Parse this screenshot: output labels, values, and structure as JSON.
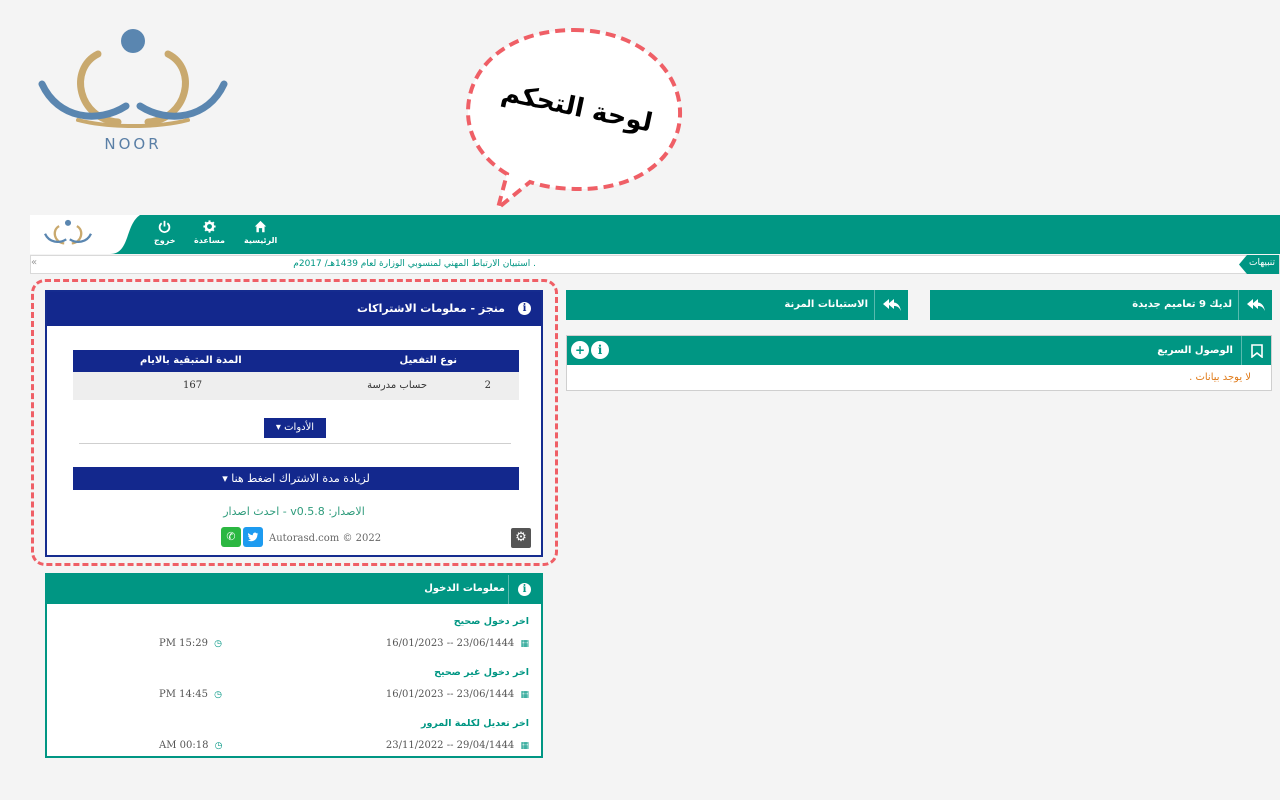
{
  "logo": {
    "text": "NOOR"
  },
  "callout": {
    "text": "لوحة التحكم"
  },
  "nav": {
    "home": "الرئيسية",
    "help": "مساعدة",
    "logout": "خروج"
  },
  "ticker": {
    "text": ". استبيان الارتباط المهني لمنسوبي الوزارة لعام 1439هـ/ 2017م",
    "tab": "تنبيهات"
  },
  "subscription": {
    "title": "منجز - معلومات الاشتراكات",
    "columns": [
      "نوع التفعيل",
      "المدة المتبقية بالايام"
    ],
    "row": {
      "index": "2",
      "type": "حساب مدرسة",
      "days": "167"
    },
    "tools_label": "الأدوات",
    "extend_label": "لزيادة مدة الاشتراك اضغط هنا",
    "version_label": "الاصدار: v0.5.8 - احدث اصدار",
    "copyright": "Autorasd.com © 2022"
  },
  "login_info": {
    "title": "معلومات الدخول",
    "entries": [
      {
        "label": "اخر دخول صحيح",
        "date": "16/01/2023 -- 23/06/1444",
        "time": "PM 15:29"
      },
      {
        "label": "اخر دخول غير صحيح",
        "date": "16/01/2023 -- 23/06/1444",
        "time": "PM 14:45"
      },
      {
        "label": "اخر تعديل لكلمة المرور",
        "date": "23/11/2022 -- 29/04/1444",
        "time": "AM 00:18"
      }
    ]
  },
  "circulars_button": "لديك 9 تعاميم جديدة",
  "surveys_button": "الاستبانات المرنة",
  "quick_access": {
    "title": "الوصول السريع",
    "empty": "لا يوجد بيانات ."
  },
  "colors": {
    "teal": "#009683",
    "navy": "#13288d",
    "dashed": "#ef5f66",
    "logo_gold": "#c9a96e",
    "logo_blue": "#5a86b0"
  }
}
